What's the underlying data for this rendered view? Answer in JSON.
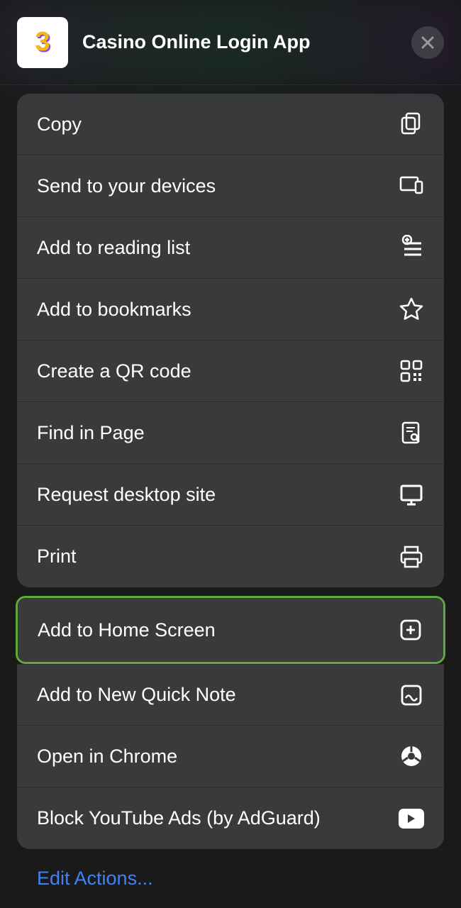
{
  "header": {
    "title": "Casino Online Login App"
  },
  "group1": [
    {
      "label": "Copy",
      "icon": "copy"
    },
    {
      "label": "Send to your devices",
      "icon": "devices"
    },
    {
      "label": "Add to reading list",
      "icon": "readinglist"
    },
    {
      "label": "Add to bookmarks",
      "icon": "star"
    },
    {
      "label": "Create a QR code",
      "icon": "qr"
    },
    {
      "label": "Find in Page",
      "icon": "findpage"
    },
    {
      "label": "Request desktop site",
      "icon": "desktop"
    },
    {
      "label": "Print",
      "icon": "print"
    }
  ],
  "highlighted": {
    "label": "Add to Home Screen",
    "icon": "plusbox"
  },
  "group2": [
    {
      "label": "Add to New Quick Note",
      "icon": "quicknote"
    },
    {
      "label": "Open in Chrome",
      "icon": "chrome"
    },
    {
      "label": "Block YouTube Ads (by AdGuard)",
      "icon": "youtube"
    }
  ],
  "footer": {
    "edit": "Edit Actions..."
  }
}
